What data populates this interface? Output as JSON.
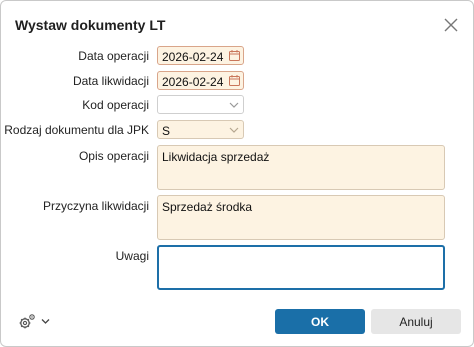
{
  "dialog": {
    "title": "Wystaw dokumenty LT",
    "close_icon": "close-icon"
  },
  "form": {
    "data_operacji": {
      "label": "Data operacji",
      "value": "2026-02-24",
      "icon": "calendar-icon"
    },
    "data_likwidacji": {
      "label": "Data likwidacji",
      "value": "2026-02-24",
      "icon": "calendar-icon"
    },
    "kod_operacji": {
      "label": "Kod operacji",
      "value": "",
      "icon": "chevron-down-icon"
    },
    "rodzaj_jpk": {
      "label": "Rodzaj dokumentu dla JPK",
      "value": "S",
      "icon": "chevron-down-icon"
    },
    "opis_operacji": {
      "label": "Opis operacji",
      "value": "Likwidacja sprzedaż"
    },
    "przyczyna": {
      "label": "Przyczyna likwidacji",
      "value": "Sprzedaż środka"
    },
    "uwagi": {
      "label": "Uwagi",
      "value": ""
    }
  },
  "footer": {
    "settings_icon": "gear-icon",
    "ok_label": "OK",
    "cancel_label": "Anuluj"
  },
  "colors": {
    "accent": "#1a6fa8",
    "field_bg": "#fdf3e2",
    "cancel_bg": "#e6e6e6"
  }
}
